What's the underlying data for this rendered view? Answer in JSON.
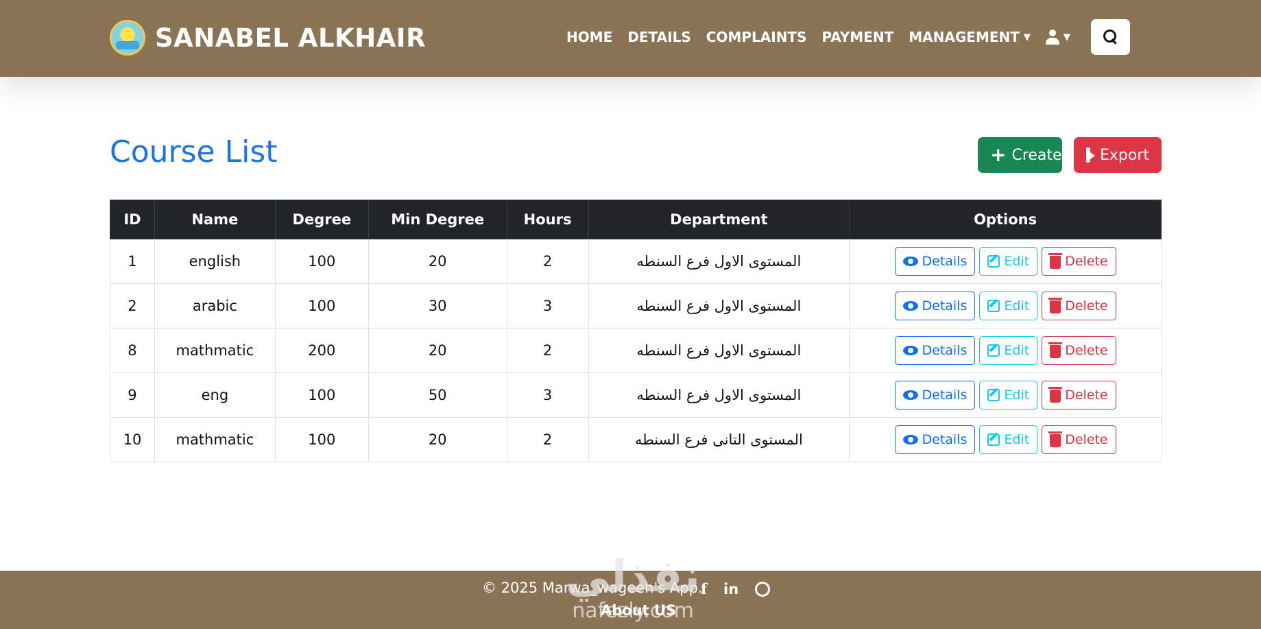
{
  "brand": {
    "name": "SANABEL ALKHAIR",
    "logo_icon": "nursery-logo"
  },
  "nav": {
    "links": [
      "HOME",
      "DETAILS",
      "COMPLAINTS",
      "PAYMENT",
      "MANAGEMENT"
    ],
    "user_icon": "user-icon",
    "search_icon": "search-icon"
  },
  "page": {
    "title": "Course List"
  },
  "actions": {
    "create_label": "Create",
    "export_label": "Export"
  },
  "table": {
    "headers": [
      "ID",
      "Name",
      "Degree",
      "Min Degree",
      "Hours",
      "Department",
      "Options"
    ],
    "rows": [
      {
        "id": "1",
        "name": "english",
        "degree": "100",
        "min_degree": "20",
        "hours": "2",
        "department": "المستوى الاول فرع السنطه"
      },
      {
        "id": "2",
        "name": "arabic",
        "degree": "100",
        "min_degree": "30",
        "hours": "3",
        "department": "المستوى الاول فرع السنطه"
      },
      {
        "id": "8",
        "name": "mathmatic",
        "degree": "200",
        "min_degree": "20",
        "hours": "2",
        "department": "المستوى الاول فرع السنطه"
      },
      {
        "id": "9",
        "name": "eng",
        "degree": "100",
        "min_degree": "50",
        "hours": "3",
        "department": "المستوى الاول فرع السنطه"
      },
      {
        "id": "10",
        "name": "mathmatic",
        "degree": "100",
        "min_degree": "20",
        "hours": "2",
        "department": "المستوى التانى فرع السنطه"
      }
    ],
    "option_labels": {
      "details": "Details",
      "edit": "Edit",
      "delete": "Delete"
    }
  },
  "footer": {
    "copyright": "© 2025 Marwa_wageeh's App.",
    "about": "About US",
    "social_icons": [
      "facebook-icon",
      "linkedin-icon",
      "github-icon"
    ]
  },
  "watermark": {
    "main": "نفذلي",
    "sub": "nafezly.com"
  },
  "colors": {
    "navbar": "#8b7355",
    "title": "#1a73e8",
    "create": "#198754",
    "export": "#dc3545",
    "table_header": "#212529"
  }
}
